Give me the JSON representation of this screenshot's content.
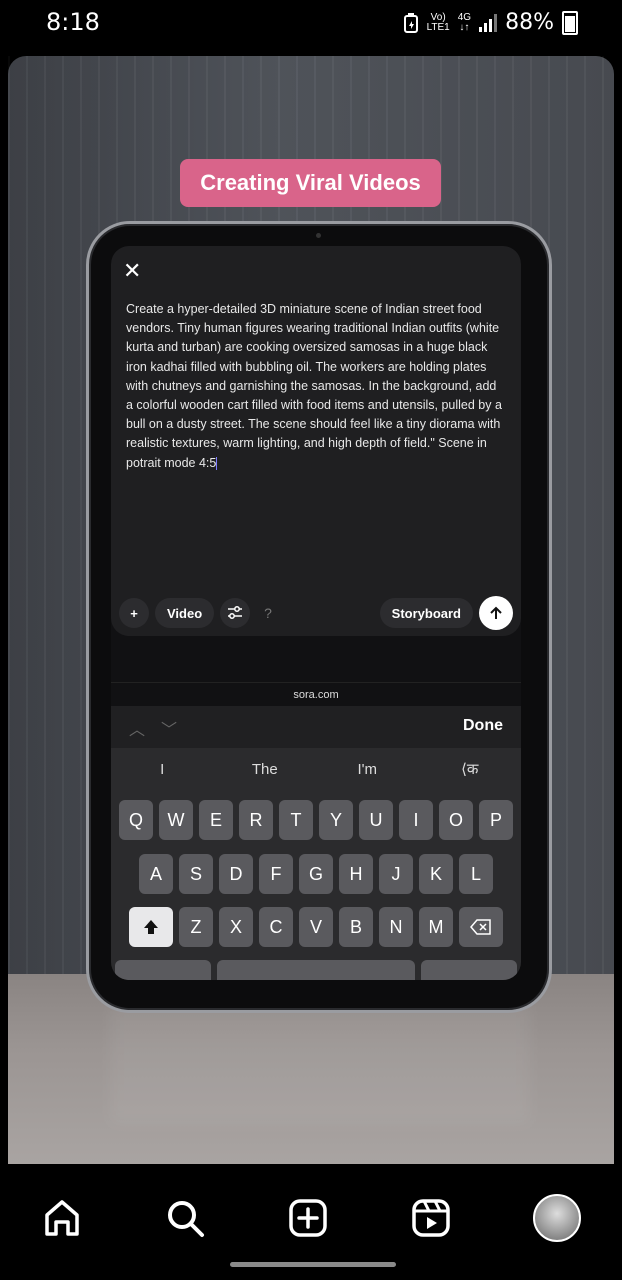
{
  "status_bar": {
    "time": "8:18",
    "network_top": "Vo)",
    "network_bottom": "LTE1",
    "data_top": "4G",
    "data_bottom": "↓↑",
    "battery": "88%"
  },
  "post": {
    "title_pill": "Creating Viral Videos"
  },
  "composer": {
    "prompt_text": "Create a hyper-detailed 3D miniature scene of Indian street food vendors. Tiny human figures wearing traditional Indian outfits (white kurta and turban) are cooking oversized samosas in a huge black iron kadhai filled with bubbling oil. The workers are holding plates with chutneys and garnishing the samosas. In the background, add a colorful wooden cart filled with food items and utensils, pulled by a bull on a dusty street. The scene should feel like a tiny diorama with realistic textures, warm lighting, and high depth of field.\" Scene in potrait mode 4:5",
    "add_label": "+",
    "video_label": "Video",
    "help_label": "?",
    "storyboard_label": "Storyboard"
  },
  "browser": {
    "url": "sora.com"
  },
  "keyboard": {
    "done_label": "Done",
    "suggestions": [
      "I",
      "The",
      "I'm",
      "⟨क"
    ],
    "row1": [
      "Q",
      "W",
      "E",
      "R",
      "T",
      "Y",
      "U",
      "I",
      "O",
      "P"
    ],
    "row2": [
      "A",
      "S",
      "D",
      "F",
      "G",
      "H",
      "J",
      "K",
      "L"
    ],
    "row3": [
      "Z",
      "X",
      "C",
      "V",
      "B",
      "N",
      "M"
    ]
  },
  "navbar": {
    "icons": [
      "home-icon",
      "search-icon",
      "create-icon",
      "reels-icon",
      "profile-avatar"
    ]
  }
}
